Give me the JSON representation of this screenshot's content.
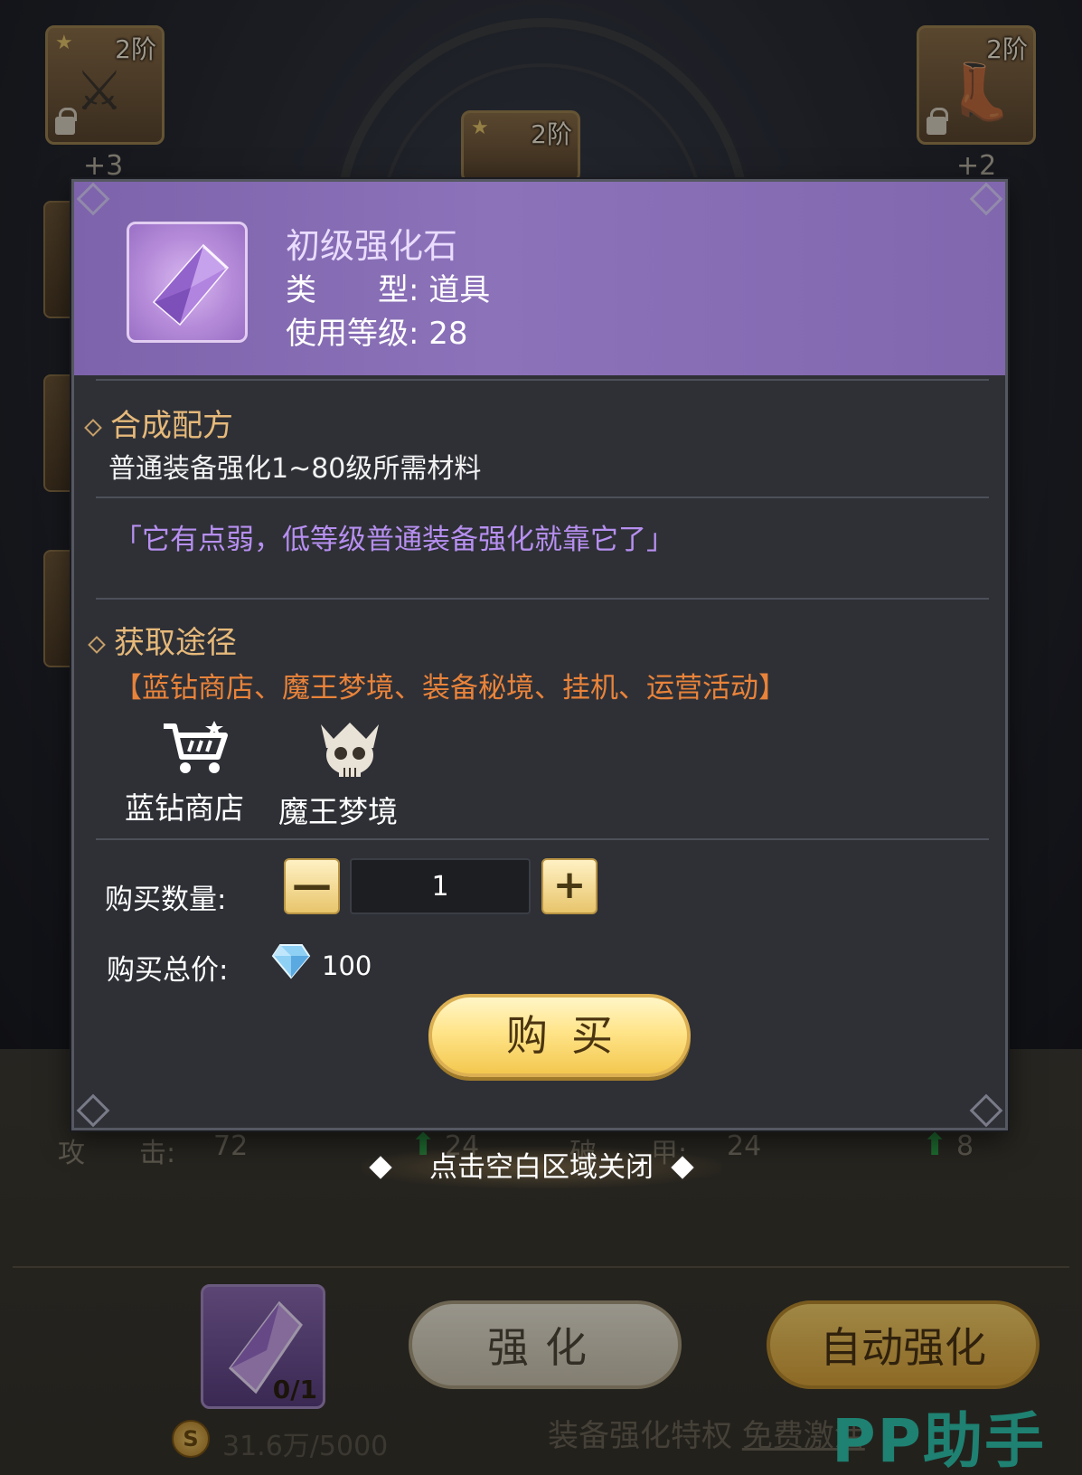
{
  "background": {
    "slots": [
      {
        "tier": "2阶",
        "plus": "+3"
      },
      {
        "tier": "2阶",
        "plus": ""
      },
      {
        "tier": "2阶",
        "plus": "+2"
      }
    ],
    "stats": {
      "attack_label": "攻　　击:",
      "attack_value": "72",
      "attack_gain": "24",
      "armor_break_label": "破　　甲:",
      "armor_break_value": "24",
      "armor_break_gain": "8"
    },
    "material_count": "0/1",
    "gold_text": "31.6万/5000",
    "strengthen_label": "强化",
    "auto_strengthen_label": "自动强化",
    "privilege_text": "装备强化特权",
    "privilege_link": "免费激活",
    "watermark": "PP助手"
  },
  "popup": {
    "item_name": "初级强化石",
    "type_line": "类　　型: 道具",
    "level_line": "使用等级: 28",
    "recipe_heading": "合成配方",
    "recipe_text": "普通装备强化1~80级所需材料",
    "flavor_quote": "「它有点弱，低等级普通装备强化就靠它了」",
    "source_heading": "获取途径",
    "sources_text": "【蓝钻商店、魔王梦境、装备秘境、挂机、运营活动】",
    "source_entries": [
      {
        "label": "蓝钻商店",
        "icon": "shopping-cart-icon"
      },
      {
        "label": "魔王梦境",
        "icon": "demon-skull-icon"
      }
    ],
    "quantity_label": "购买数量:",
    "quantity_value": "1",
    "minus_symbol": "—",
    "plus_symbol": "+",
    "price_label": "购买总价:",
    "price_value": "100",
    "buy_label": "购买"
  },
  "close_hint": "点击空白区域关闭",
  "colors": {
    "header_purple": "#8167ae",
    "section_heading": "#e6b97a",
    "quote": "#b78ff0",
    "sources": "#e9833a",
    "buy_button": "#f3c84f"
  }
}
